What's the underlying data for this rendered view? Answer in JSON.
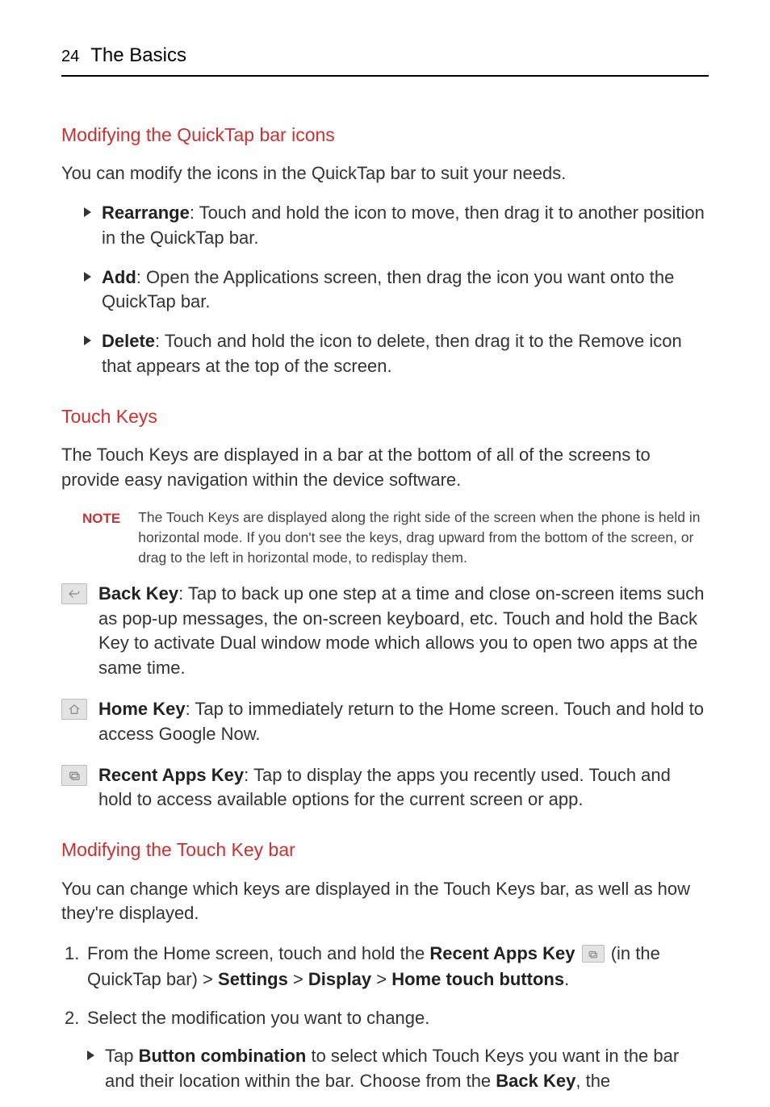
{
  "header": {
    "page_number": "24",
    "section": "The Basics"
  },
  "s1": {
    "heading": "Modifying the QuickTap bar icons",
    "intro": "You can modify the icons in the QuickTap bar to suit your needs.",
    "items": {
      "rearrange_label": "Rearrange",
      "rearrange_text": ": Touch and hold the icon to move, then drag it to another position in the QuickTap bar.",
      "add_label": "Add",
      "add_text": ": Open the Applications screen, then drag the icon you want onto the QuickTap bar.",
      "delete_label": "Delete",
      "delete_text": ": Touch and hold the icon to delete, then drag it to the Remove icon that appears at the top of the screen."
    }
  },
  "s2": {
    "heading": "Touch Keys",
    "intro": "The Touch Keys are displayed in a bar at the bottom of all of the screens to provide easy navigation within the device software.",
    "note_label": "NOTE",
    "note_text": "The Touch Keys are displayed along the right side of the screen when the phone is held in horizontal mode. If you don't see the keys, drag upward from the bottom of the screen, or drag to the left in horizontal mode, to redisplay them.",
    "keys": {
      "back_label": "Back Key",
      "back_text": ": Tap to back up one step at a time and close on-screen items such as pop-up messages, the on-screen keyboard, etc. Touch and hold the Back Key to activate Dual window mode which allows you to open two apps at the same time.",
      "home_label": "Home Key",
      "home_text": ": Tap to immediately return to the Home screen. Touch and hold to access Google Now.",
      "recent_label": "Recent Apps Key",
      "recent_text": ": Tap to display the apps you recently used. Touch and hold to access available options for the current screen or app."
    }
  },
  "s3": {
    "heading": "Modifying the Touch Key bar",
    "intro": "You can change which keys are displayed in the Touch Keys bar, as well as how they're displayed.",
    "step1_pre": "From the Home screen, touch and hold the ",
    "step1_bold1": "Recent Apps Key",
    "step1_mid": " (in the QuickTap bar) > ",
    "step1_bold2": "Settings",
    "step1_gt1": " > ",
    "step1_bold3": "Display",
    "step1_gt2": " > ",
    "step1_bold4": "Home touch buttons",
    "step1_end": ".",
    "step2": "Select the modification you want to change.",
    "sub_pre": "Tap ",
    "sub_bold1": "Button combination",
    "sub_mid": " to select which Touch Keys you want in the bar and their location within the bar. Choose from the ",
    "sub_bold2": "Back Key",
    "sub_end": ", the"
  }
}
